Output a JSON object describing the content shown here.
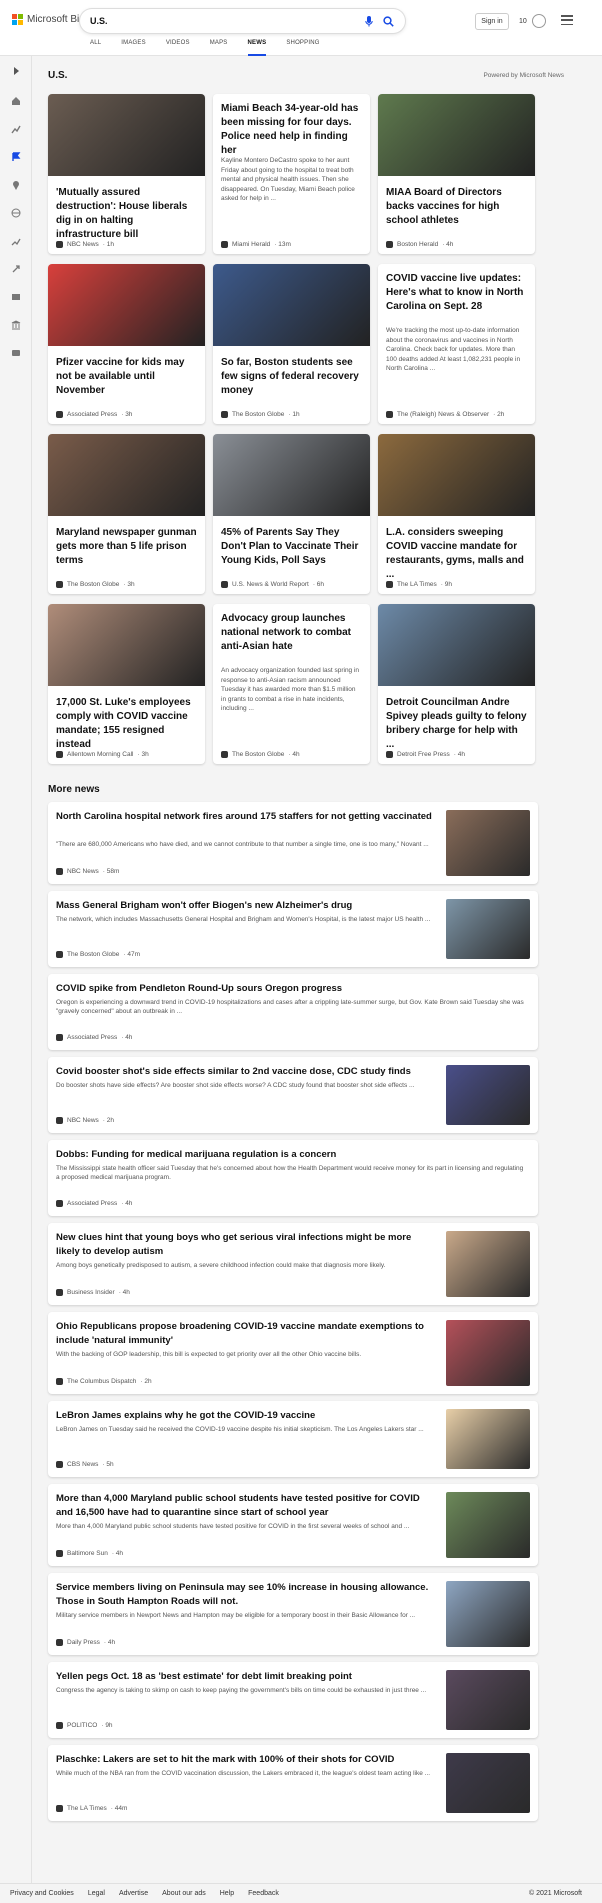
{
  "header": {
    "logo_text": "Microsoft Bing",
    "query": "U.S.",
    "signin": "Sign in",
    "rewards_count": "10"
  },
  "tabs": [
    "ALL",
    "IMAGES",
    "VIDEOS",
    "MAPS",
    "NEWS",
    "SHOPPING"
  ],
  "section": {
    "title": "U.S.",
    "powered": "Powered by Microsoft News"
  },
  "cards": [
    {
      "title": "'Mutually assured destruction': House liberals dig in on halting infrastructure bill",
      "provider": "NBC News",
      "time": " · 1h",
      "color": "#6b5d52"
    },
    {
      "title": "Miami Beach 34-year-old has been missing for four days. Police need help in finding her",
      "abstract": "Kayline Montero DeCastro spoke to her aunt Friday about going to the hospital to treat both mental and physical health issues. Then she disappeared. On Tuesday, Miami Beach police asked for help in ...",
      "provider": "Miami Herald",
      "time": " · 13m"
    },
    {
      "title": "MIAA Board of Directors backs vaccines for high school athletes",
      "provider": "Boston Herald",
      "time": " · 4h",
      "color": "#5f7a4e"
    },
    {
      "title": "Pfizer vaccine for kids may not be available until November",
      "provider": "Associated Press",
      "time": " · 3h",
      "color": "#d8403c"
    },
    {
      "title": "So far, Boston students see few signs of federal recovery money",
      "provider": "The Boston Globe",
      "time": " · 1h",
      "color": "#3d5a8c"
    },
    {
      "title": "COVID vaccine live updates: Here's what to know in North Carolina on Sept. 28",
      "abstract": "We're tracking the most up-to-date information about the coronavirus and vaccines in North Carolina. Check back for updates. More than 100 deaths added At least 1,082,231 people in North Carolina ...",
      "provider": "The (Raleigh) News & Observer",
      "time": " · 2h"
    },
    {
      "title": "Maryland newspaper gunman gets more than 5 life prison terms",
      "provider": "The Boston Globe",
      "time": " · 3h",
      "color": "#7a5c4a"
    },
    {
      "title": "45% of Parents Say They Don't Plan to Vaccinate Their Young Kids, Poll Says",
      "provider": "U.S. News & World Report",
      "time": " · 6h",
      "color": "#8a8f96"
    },
    {
      "title": "L.A. considers sweeping COVID vaccine mandate for restaurants, gyms, malls and ...",
      "provider": "The LA Times",
      "time": " · 9h",
      "color": "#8c6a3e"
    },
    {
      "title": "17,000 St. Luke's employees comply with COVID vaccine mandate; 155 resigned instead",
      "provider": "Allentown Morning Call",
      "time": " · 3h",
      "color": "#b08d7a"
    },
    {
      "title": "Advocacy group launches national network to combat anti-Asian hate",
      "abstract": "An advocacy organization founded last spring in response to anti-Asian racism announced Tuesday it has awarded more than $1.5 million in grants to combat a rise in hate incidents, including ...",
      "provider": "The Boston Globe",
      "time": " · 4h"
    },
    {
      "title": "Detroit Councilman Andre Spivey pleads guilty to felony bribery charge for help with ...",
      "provider": "Detroit Free Press",
      "time": " · 4h",
      "color": "#6d8aa8"
    }
  ],
  "more": {
    "title": "More news",
    "items": [
      {
        "title": "North Carolina hospital network fires around 175 staffers for not getting vaccinated",
        "snippet": "\"There are 680,000 Americans who have died, and we cannot contribute to that number a single time, one is too many,\" Novant ...",
        "provider": "NBC News",
        "time": " · 58m",
        "color": "#8a6d5a"
      },
      {
        "title": "Mass General Brigham won't offer Biogen's new Alzheimer's drug",
        "snippet": "The network, which includes Massachusetts General Hospital and Brigham and Women's Hospital, is the latest major US health ...",
        "provider": "The Boston Globe",
        "time": " · 47m",
        "color": "#7e96a8"
      },
      {
        "title": "COVID spike from Pendleton Round-Up sours Oregon progress",
        "snippet": "Oregon is experiencing a downward trend in COVID-19 hospitalizations and cases after a crippling late-summer surge, but Gov. Kate Brown said Tuesday she was \"gravely concerned\" about an outbreak in ...",
        "provider": "Associated Press",
        "time": " · 4h"
      },
      {
        "title": "Covid booster shot's side effects similar to 2nd vaccine dose, CDC study finds",
        "snippet": "Do booster shots have side effects? Are booster shot side effects worse? A CDC study found that booster shot side effects ...",
        "provider": "NBC News",
        "time": " · 2h",
        "color": "#4a4f8a"
      },
      {
        "title": "Dobbs: Funding for medical marijuana regulation is a concern",
        "snippet": "The Mississippi state health officer said Tuesday that he's concerned about how the Health Department would receive money for its part in licensing and regulating a proposed medical marijuana program.",
        "provider": "Associated Press",
        "time": " · 4h"
      },
      {
        "title": "New clues hint that young boys who get serious viral infections might be more likely to develop autism",
        "snippet": "Among boys genetically predisposed to autism, a severe childhood infection could make that diagnosis more likely.",
        "provider": "Business Insider",
        "time": " · 4h",
        "color": "#c9a98a"
      },
      {
        "title": "Ohio Republicans propose broadening COVID-19 vaccine mandate exemptions to include 'natural immunity'",
        "snippet": "With the backing of GOP leadership, this bill is expected to get priority over all the other Ohio vaccine bills.",
        "provider": "The Columbus Dispatch",
        "time": " · 2h",
        "color": "#b5515a"
      },
      {
        "title": "LeBron James explains why he got the COVID-19 vaccine",
        "snippet": "LeBron James on Tuesday said he received the COVID-19 vaccine despite his initial skepticism. The Los Angeles Lakers star ...",
        "provider": "CBS News",
        "time": " · 5h",
        "color": "#e8cfa8"
      },
      {
        "title": "More than 4,000 Maryland public school students have tested positive for COVID and 16,500 have had to quarantine since start of school year",
        "snippet": "More than 4,000 Maryland public school students have tested positive for COVID in the first several weeks of school and ...",
        "provider": "Baltimore Sun",
        "time": " · 4h",
        "color": "#6d8a5a"
      },
      {
        "title": "Service members living on Peninsula may see 10% increase in housing allowance. Those in South Hampton Roads will not.",
        "snippet": "Military service members in Newport News and Hampton may be eligible for a temporary boost in their Basic Allowance for ...",
        "provider": "Daily Press",
        "time": " · 4h",
        "color": "#8ea6c2"
      },
      {
        "title": "Yellen pegs Oct. 18 as 'best estimate' for debt limit breaking point",
        "snippet": "Congress the agency is taking to skimp on cash to keep paying the government's bills on time could be exhausted in just three ...",
        "provider": "POLITICO",
        "time": " · 9h",
        "color": "#5a4a5e"
      },
      {
        "title": "Plaschke: Lakers are set to hit the mark with 100% of their shots for COVID",
        "snippet": "While much of the NBA ran from the COVID vaccination discussion, the Lakers embraced it, the league's oldest team acting like ...",
        "provider": "The LA Times",
        "time": " · 44m",
        "color": "#3e3a4a"
      }
    ]
  },
  "footer": {
    "links": [
      "Privacy and Cookies",
      "Legal",
      "Advertise",
      "About our ads",
      "Help",
      "Feedback"
    ],
    "copyright": "© 2021 Microsoft"
  }
}
